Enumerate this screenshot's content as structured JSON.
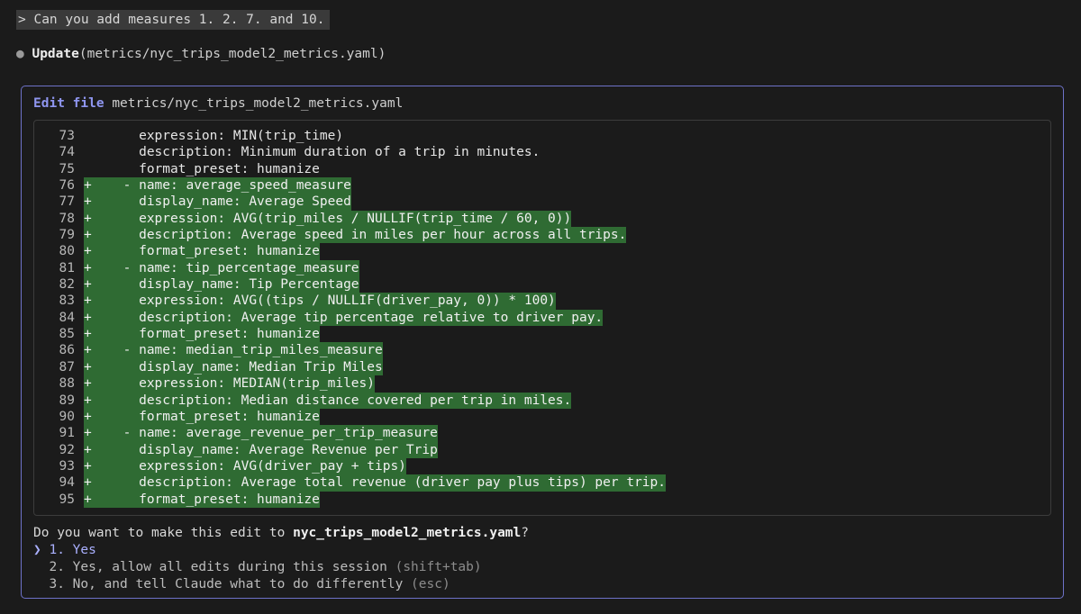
{
  "prompt": {
    "text": "> Can you add measures 1. 2. 7. and 10."
  },
  "tool_call": {
    "bullet": "●",
    "action": "Update",
    "args": "(metrics/nyc_trips_model2_metrics.yaml)"
  },
  "edit": {
    "label": "Edit file",
    "path": "metrics/nyc_trips_model2_metrics.yaml",
    "lines": [
      {
        "num": "73",
        "marker": "",
        "code": "      expression: MIN(trip_time)",
        "added": false
      },
      {
        "num": "74",
        "marker": "",
        "code": "      description: Minimum duration of a trip in minutes.",
        "added": false
      },
      {
        "num": "75",
        "marker": "",
        "code": "      format_preset: humanize",
        "added": false
      },
      {
        "num": "76",
        "marker": "+",
        "code": "    - name: average_speed_measure",
        "added": true
      },
      {
        "num": "77",
        "marker": "+",
        "code": "      display_name: Average Speed",
        "added": true
      },
      {
        "num": "78",
        "marker": "+",
        "code": "      expression: AVG(trip_miles / NULLIF(trip_time / 60, 0))",
        "added": true
      },
      {
        "num": "79",
        "marker": "+",
        "code": "      description: Average speed in miles per hour across all trips.",
        "added": true
      },
      {
        "num": "80",
        "marker": "+",
        "code": "      format_preset: humanize",
        "added": true
      },
      {
        "num": "81",
        "marker": "+",
        "code": "    - name: tip_percentage_measure",
        "added": true
      },
      {
        "num": "82",
        "marker": "+",
        "code": "      display_name: Tip Percentage",
        "added": true
      },
      {
        "num": "83",
        "marker": "+",
        "code": "      expression: AVG((tips / NULLIF(driver_pay, 0)) * 100)",
        "added": true
      },
      {
        "num": "84",
        "marker": "+",
        "code": "      description: Average tip percentage relative to driver pay.",
        "added": true
      },
      {
        "num": "85",
        "marker": "+",
        "code": "      format_preset: humanize",
        "added": true
      },
      {
        "num": "86",
        "marker": "+",
        "code": "    - name: median_trip_miles_measure",
        "added": true
      },
      {
        "num": "87",
        "marker": "+",
        "code": "      display_name: Median Trip Miles",
        "added": true
      },
      {
        "num": "88",
        "marker": "+",
        "code": "      expression: MEDIAN(trip_miles)",
        "added": true
      },
      {
        "num": "89",
        "marker": "+",
        "code": "      description: Median distance covered per trip in miles.",
        "added": true
      },
      {
        "num": "90",
        "marker": "+",
        "code": "      format_preset: humanize",
        "added": true
      },
      {
        "num": "91",
        "marker": "+",
        "code": "    - name: average_revenue_per_trip_measure",
        "added": true
      },
      {
        "num": "92",
        "marker": "+",
        "code": "      display_name: Average Revenue per Trip",
        "added": true
      },
      {
        "num": "93",
        "marker": "+",
        "code": "      expression: AVG(driver_pay + tips)",
        "added": true
      },
      {
        "num": "94",
        "marker": "+",
        "code": "      description: Average total revenue (driver pay plus tips) per trip.",
        "added": true
      },
      {
        "num": "95",
        "marker": "+",
        "code": "      format_preset: humanize",
        "added": true
      }
    ]
  },
  "question": {
    "prefix": "Do you want to make this edit to ",
    "filename": "nyc_trips_model2_metrics.yaml",
    "suffix": "?"
  },
  "options": [
    {
      "caret": "❯",
      "label": "1. Yes",
      "hint": ""
    },
    {
      "caret": " ",
      "label": "2. Yes, allow all edits during this session",
      "hint": "(shift+tab)"
    },
    {
      "caret": " ",
      "label": "3. No, and tell Claude what to do differently",
      "hint": "(esc)"
    }
  ],
  "colors": {
    "added_bg": "#2f6b33",
    "accent": "#8f96f0",
    "border": "#6e72c8"
  }
}
